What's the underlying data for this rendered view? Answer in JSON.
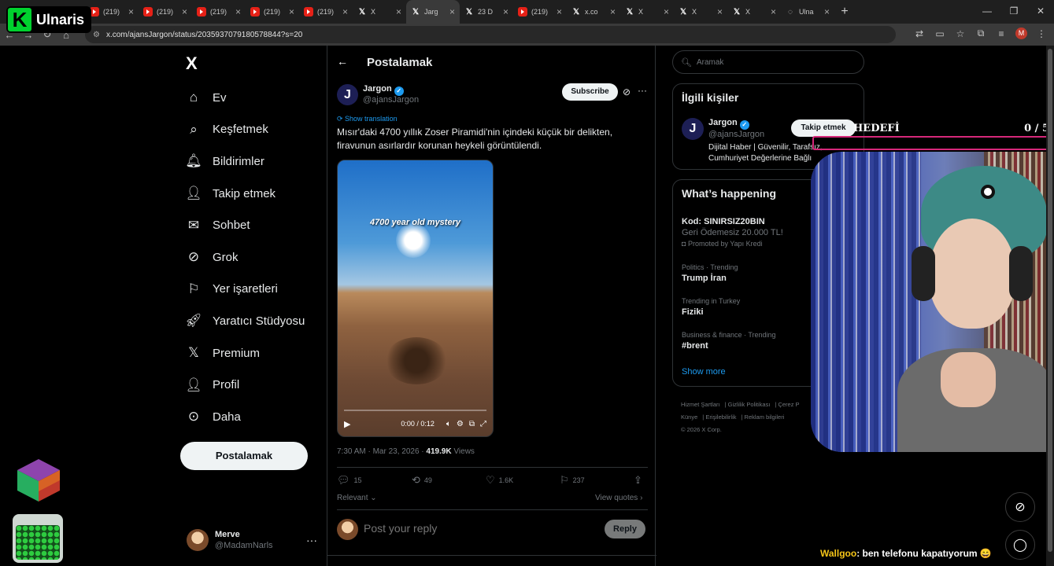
{
  "browser": {
    "tabs": [
      {
        "icon": "youtube",
        "title": "(219)"
      },
      {
        "icon": "youtube",
        "title": "(219)"
      },
      {
        "icon": "youtube",
        "title": "(219)"
      },
      {
        "icon": "youtube",
        "title": "(219)"
      },
      {
        "icon": "youtube",
        "title": "(219)"
      },
      {
        "icon": "youtube",
        "title": "(219)"
      },
      {
        "icon": "x",
        "title": "X"
      },
      {
        "icon": "x",
        "title": "Jarg",
        "active": true
      },
      {
        "icon": "x",
        "title": "23 D"
      },
      {
        "icon": "youtube",
        "title": "(219)"
      },
      {
        "icon": "x",
        "title": "x.co"
      },
      {
        "icon": "x",
        "title": "X"
      },
      {
        "icon": "x",
        "title": "X"
      },
      {
        "icon": "x",
        "title": "X"
      },
      {
        "icon": "web",
        "title": "Ulna"
      }
    ],
    "url": "x.com/ajansJargon/status/2035937079180578844?s=20",
    "profile_initial": "M"
  },
  "stream": {
    "logo_letter": "K",
    "logo_name": "Ulnaris",
    "goal_label": "HEDEFİ",
    "goal_count": "0 / 5",
    "chat_user": "Wallgoo",
    "chat_message": ": ben telefonu kapatıyorum 😄"
  },
  "sidebar": {
    "logo": "X",
    "items": [
      {
        "label": "Ev",
        "icon": "home-icon"
      },
      {
        "label": "Keşfetmek",
        "icon": "search-icon"
      },
      {
        "label": "Bildirimler",
        "icon": "bell-icon"
      },
      {
        "label": "Takip etmek",
        "icon": "add-person-icon"
      },
      {
        "label": "Sohbet",
        "icon": "mail-icon"
      },
      {
        "label": "Grok",
        "icon": "grok-icon"
      },
      {
        "label": "Yer işaretleri",
        "icon": "bookmark-icon"
      },
      {
        "label": "Yaratıcı Stüdyosu",
        "icon": "rocket-icon"
      },
      {
        "label": "Premium",
        "icon": "x-logo-icon"
      },
      {
        "label": "Profil",
        "icon": "person-icon"
      },
      {
        "label": "Daha",
        "icon": "more-circle-icon"
      }
    ],
    "post_button": "Postalamak",
    "user": {
      "name": "Merve",
      "handle": "@MadamNarls"
    }
  },
  "main": {
    "title": "Postalamak",
    "author": {
      "initial": "J",
      "name": "Jargon",
      "handle": "@ajansJargon"
    },
    "subscribe_label": "Subscribe",
    "show_translation": "Show translation",
    "text": "Mısır'daki 4700 yıllık Zoser Piramidi'nin içindeki küçük bir delikten, firavunun asırlardır korunan heykeli görüntülendi.",
    "video": {
      "caption": "4700 year old mystery",
      "time": "0:00 / 0:12",
      "progress": 0
    },
    "timestamp": "7:30 AM · Mar 23, 2026 · ",
    "views_count": "419.9K",
    "views_label": " Views",
    "stats": {
      "replies": "15",
      "reposts": "49",
      "likes": "1.6K",
      "bookmarks": "237"
    },
    "relevant_label": "Relevant",
    "view_quotes_label": "View quotes",
    "reply_placeholder": "Post your reply",
    "reply_button": "Reply"
  },
  "right": {
    "search_placeholder": "Aramak",
    "related": {
      "title": "İlgili kişiler",
      "initial": "J",
      "name": "Jargon",
      "handle": "@ajansJargon",
      "bio": "Dijital Haber | Güvenilir, Tarafsız, Cumhuriyet Değerlerine Bağlı",
      "follow_label": "Takip etmek"
    },
    "happening": {
      "title": "What’s happening",
      "trends": [
        {
          "meta": "",
          "name": "Kod: SINIRSIZ20BIN",
          "sub": "Geri Ödemesiz 20.000 TL!",
          "promo": "Promoted by Yapı Kredi"
        },
        {
          "meta": "Politics · Trending",
          "name": "Trump İran"
        },
        {
          "meta": "Trending in Turkey",
          "name": "Fiziki"
        },
        {
          "meta": "Business & finance · Trending",
          "name": "#brent"
        }
      ],
      "show_more": "Show more"
    },
    "footer": {
      "links": [
        "Hizmet Şartları",
        "Gizlilik Politikası",
        "Çerez P",
        "Künye",
        "Erişilebilirlik",
        "Reklam bilgileri"
      ],
      "copyright": "© 2026 X Corp."
    }
  }
}
